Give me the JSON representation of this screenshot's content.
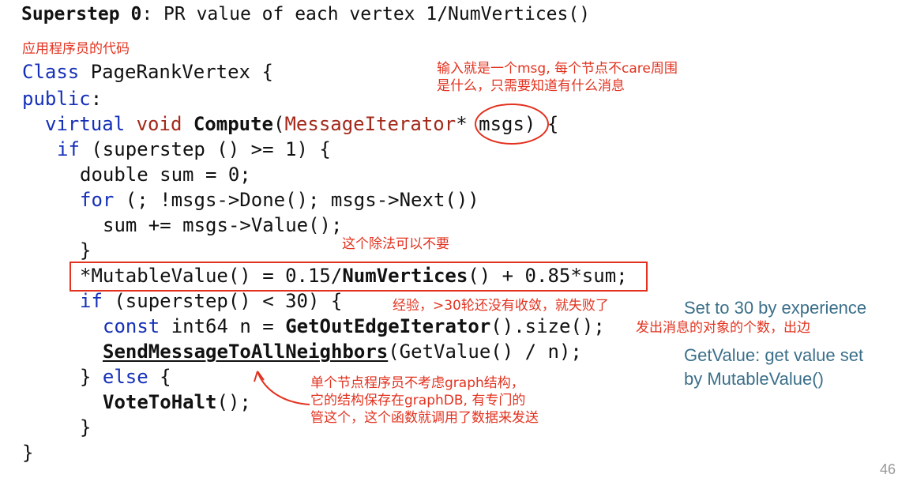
{
  "title": {
    "bold": "Superstep 0",
    "rest": ": PR value of each vertex 1/NumVertices()"
  },
  "code_label": "应用程序员的代码",
  "code": {
    "l1": {
      "kw": "Class",
      "rest": " PageRankVertex {"
    },
    "l2": {
      "kw": "public",
      "rest": ":"
    },
    "l3": {
      "kw1": "virtual",
      "kw2": "void",
      "fn": "Compute",
      "p1": "(",
      "ty": "MessageIterator",
      "p2": "* msgs) {"
    },
    "l4": {
      "kw": "if",
      "rest": " (superstep () >= 1) {"
    },
    "l5": "double sum = 0;",
    "l6": {
      "kw": "for",
      "rest": " (; !msgs->Done(); msgs->Next())"
    },
    "l7": "sum += msgs->Value();",
    "l8": "}",
    "l9": {
      "pre": "*MutableValue() = 0.15/",
      "fn": "NumVertices",
      "post": "() + 0.85*sum;"
    },
    "l10": {
      "kw": "if",
      "rest": " (superstep() < 30) {"
    },
    "l11": {
      "kw": "const",
      "mid": " int64 n = ",
      "fn": "GetOutEdgeIterator",
      "post": "().size();"
    },
    "l12": {
      "fn": "SendMessageToAllNeighbors",
      "post": "(GetValue() / n);"
    },
    "l13": {
      "pre": "} ",
      "kw": "else",
      "post": " {"
    },
    "l14": {
      "fn": "VoteToHalt",
      "post": "();"
    },
    "l15": "}",
    "l16": "}"
  },
  "notes": {
    "msg_input_1": "输入就是一个msg, 每个节点不care周围",
    "msg_input_2": "是什么，只需要知道有什么消息",
    "division": "这个除法可以不要",
    "experience": "经验，>30轮还没有收敛，就失败了",
    "out_edges": "发出消息的对象的个数，出边",
    "graph_1": "单个节点程序员不考虑graph结构，",
    "graph_2": "它的结构保存在graphDB, 有专门的",
    "graph_3": "管这个，这个函数就调用了数据来发送"
  },
  "side_notes": {
    "set30": "Set to 30 by experience",
    "getvalue_1": "GetValue: get value set",
    "getvalue_2": "by MutableValue()"
  },
  "page_number": "46",
  "colors": {
    "keyword": "#1530b8",
    "type": "#a3291a",
    "annotation": "#e2321f",
    "side_note": "#3b6f8a"
  }
}
